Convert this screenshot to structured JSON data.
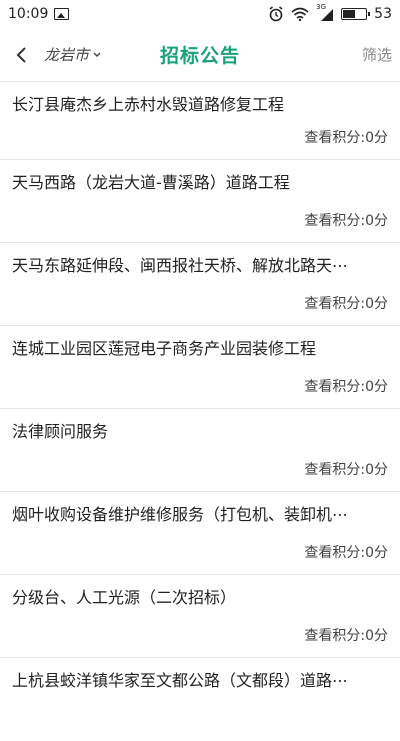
{
  "status": {
    "time": "10:09",
    "network": "3G",
    "battery_level": "53"
  },
  "header": {
    "city": "龙岩市",
    "title": "招标公告",
    "filter_label": "筛选"
  },
  "list": [
    {
      "title": "长汀县庵杰乡上赤村水毁道路修复工程",
      "points": "查看积分:0分"
    },
    {
      "title": "天马西路（龙岩大道-曹溪路）道路工程",
      "points": "查看积分:0分"
    },
    {
      "title": "天马东路延伸段、闽西报社天桥、解放北路天⋯",
      "points": "查看积分:0分"
    },
    {
      "title": "连城工业园区莲冠电子商务产业园装修工程",
      "points": "查看积分:0分"
    },
    {
      "title": "法律顾问服务",
      "points": "查看积分:0分"
    },
    {
      "title": "烟叶收购设备维护维修服务（打包机、装卸机⋯",
      "points": "查看积分:0分"
    },
    {
      "title": "分级台、人工光源（二次招标）",
      "points": "查看积分:0分"
    },
    {
      "title": "上杭县蛟洋镇华家至文都公路（文都段）道路⋯",
      "points": ""
    }
  ]
}
